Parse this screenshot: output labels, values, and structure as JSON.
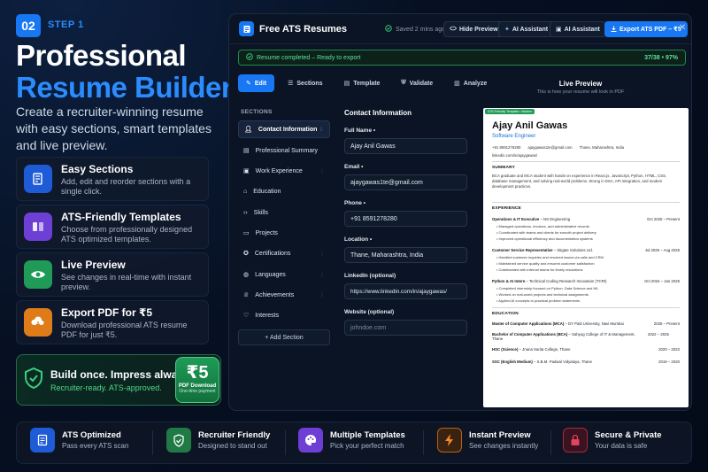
{
  "hero": {
    "step_number": "02",
    "step_label": "STEP 1",
    "title_line1": "Professional",
    "title_line2": "Resume Builder",
    "tagline": "Create a recruiter-winning resume with easy sections, smart templates and live preview."
  },
  "features": [
    {
      "title": "Easy Sections",
      "desc": "Add, edit and reorder sections with a single click.",
      "icon": "edit-document-icon",
      "color": "#1e5bd6"
    },
    {
      "title": "ATS-Friendly Templates",
      "desc": "Choose from professionally designed ATS optimized templates.",
      "icon": "template-icon",
      "color": "#6d3fd4"
    },
    {
      "title": "Live Preview",
      "desc": "See changes in real-time with instant preview.",
      "icon": "eye-icon",
      "color": "#1f9b57"
    },
    {
      "title": "Export PDF for ₹5",
      "desc": "Download professional ATS resume PDF for just ₹5.",
      "icon": "download-icon",
      "color": "#e07b1a"
    }
  ],
  "promo": {
    "line1": "Build once. Impress always.",
    "line2": "Recruiter-ready. ATS-approved.",
    "price": "₹5",
    "price_label": "PDF Download",
    "price_sub": "One-time payment"
  },
  "app": {
    "title": "Free ATS Resumes",
    "saved": "Saved 2 mins ago",
    "buttons": {
      "hide_preview": "Hide Preview",
      "ai_assistant_1": "AI Assistant",
      "ai_assistant_2": "AI Assistant",
      "export": "Export ATS PDF – ₹5"
    },
    "progress": {
      "label": "Resume completed – Ready to export",
      "count": "37/38 • 97%",
      "value": 0.97
    },
    "tabs": [
      "Edit",
      "Sections",
      "Template",
      "Validate",
      "Analyze"
    ],
    "sections_heading": "SECTIONS",
    "sections": [
      "Contact Information",
      "Professional Summary",
      "Work Experience",
      "Education",
      "Skills",
      "Projects",
      "Certifications",
      "Languages",
      "Achievements",
      "Interests"
    ],
    "add_section": "+ Add Section",
    "form": {
      "heading": "Contact Information",
      "fields": [
        {
          "label": "Full Name •",
          "value": "Ajay Anil Gawas",
          "placeholder": false
        },
        {
          "label": "Email •",
          "value": "ajaygawas1te@gmail.com",
          "placeholder": false
        },
        {
          "label": "Phone •",
          "value": "+91 8591278280",
          "placeholder": false
        },
        {
          "label": "Location •",
          "value": "Thane, Maharashtra, India",
          "placeholder": false
        },
        {
          "label": "LinkedIn (optional)",
          "value": "https://www.linkedin.com/in/ajaygawas/",
          "placeholder": false
        },
        {
          "label": "Website (optional)",
          "value": "johndoe.com",
          "placeholder": true
        }
      ]
    },
    "preview": {
      "heading": "Live Preview",
      "sub": "This is how your resume will look in PDF"
    }
  },
  "resume": {
    "tag": "ATS-Friendly Template • Modern",
    "name": "Ajay Anil Gawas",
    "role": "Software Engineer",
    "phone": "+91 8591278280",
    "email": "ajaygawas1te@gmail.com",
    "location": "Thane, Maharashtra, India",
    "linkedin": "linkedin.com/in/ajaygawas/",
    "summary_h": "SUMMARY",
    "summary": "BCA graduate and MCA student with hands-on experience in React.js, JavaScript, Python, HTML, CSS, database management, and solving real-world problems. Strong in DSA, API integration, and modern development practices.",
    "experience_h": "EXPERIENCE",
    "jobs": [
      {
        "title": "Operations & IT Executive",
        "org": "NS Engineering",
        "date": "Oct 2025 – Present",
        "bullets": [
          "Managed operations, invoices, and administrative records",
          "Coordinated with teams and clients for smooth project delivery",
          "Improved operational efficiency and documentation systems"
        ]
      },
      {
        "title": "Customer Service Representative",
        "org": "Sitgate Solutions Ltd.",
        "date": "Jul 2025 – Aug 2025",
        "bullets": [
          "Handled customer inquiries and resolved issues via calls and CRM",
          "Maintained service quality and ensured customer satisfaction",
          "Collaborated with internal teams for timely resolutions"
        ]
      },
      {
        "title": "Python & AI Intern",
        "org": "Technical Coding Research Innovation (TCRI)",
        "date": "Oct 2024 – Jan 2025",
        "bullets": [
          "Completed internship focused on Python, Data Science and ML",
          "Worked on real-world projects and technical assignments",
          "Applied AI concepts to practical problem statements"
        ]
      }
    ],
    "education_h": "EDUCATION",
    "education": [
      {
        "degree": "Master of Computer Applications (MCA)",
        "school": "DY Patil University, Navi Mumbai",
        "date": "2025 – Present"
      },
      {
        "degree": "Bachelor of Computer Applications (BCA)",
        "school": "Sahyog College of IT & Management, Thane",
        "date": "2022 – 2025"
      },
      {
        "degree": "HSC (Science)",
        "school": "Jnana Sarita College, Thane",
        "date": "2020 – 2022"
      },
      {
        "degree": "SSC (English Medium)",
        "school": "S.B.M. Padwal Vidyalaya, Thane",
        "date": "2019 – 2020"
      }
    ]
  },
  "bottom": [
    {
      "title": "ATS Optimized",
      "desc": "Pass every ATS scan",
      "icon": "document-icon",
      "color": "#1e5bd6"
    },
    {
      "title": "Recruiter Friendly",
      "desc": "Designed to stand out",
      "icon": "shield-check-icon",
      "color": "#1f7a45"
    },
    {
      "title": "Multiple Templates",
      "desc": "Pick your perfect match",
      "icon": "palette-icon",
      "color": "#6d3fd4"
    },
    {
      "title": "Instant Preview",
      "desc": "See changes instantly",
      "icon": "lightning-icon",
      "color": "#b8601a"
    },
    {
      "title": "Secure & Private",
      "desc": "Your data is safe",
      "icon": "lock-icon",
      "color": "#a8283e"
    }
  ]
}
